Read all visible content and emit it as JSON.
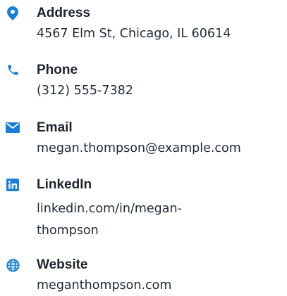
{
  "theme": {
    "icon_color": "#1a7fd4",
    "label_color": "#1d2430",
    "value_color": "#1f2a3a"
  },
  "contact": {
    "items": [
      {
        "icon": "map-pin-icon",
        "label": "Address",
        "value": "4567 Elm St, Chicago, IL 60614"
      },
      {
        "icon": "phone-icon",
        "label": "Phone",
        "value": "(312) 555-7382"
      },
      {
        "icon": "envelope-icon",
        "label": "Email",
        "value": "megan.thompson@example.com"
      },
      {
        "icon": "linkedin-icon",
        "label": "LinkedIn",
        "value": "linkedin.com/in/megan-\nthompson"
      },
      {
        "icon": "globe-icon",
        "label": "Website",
        "value": "meganthompson.com"
      }
    ]
  }
}
